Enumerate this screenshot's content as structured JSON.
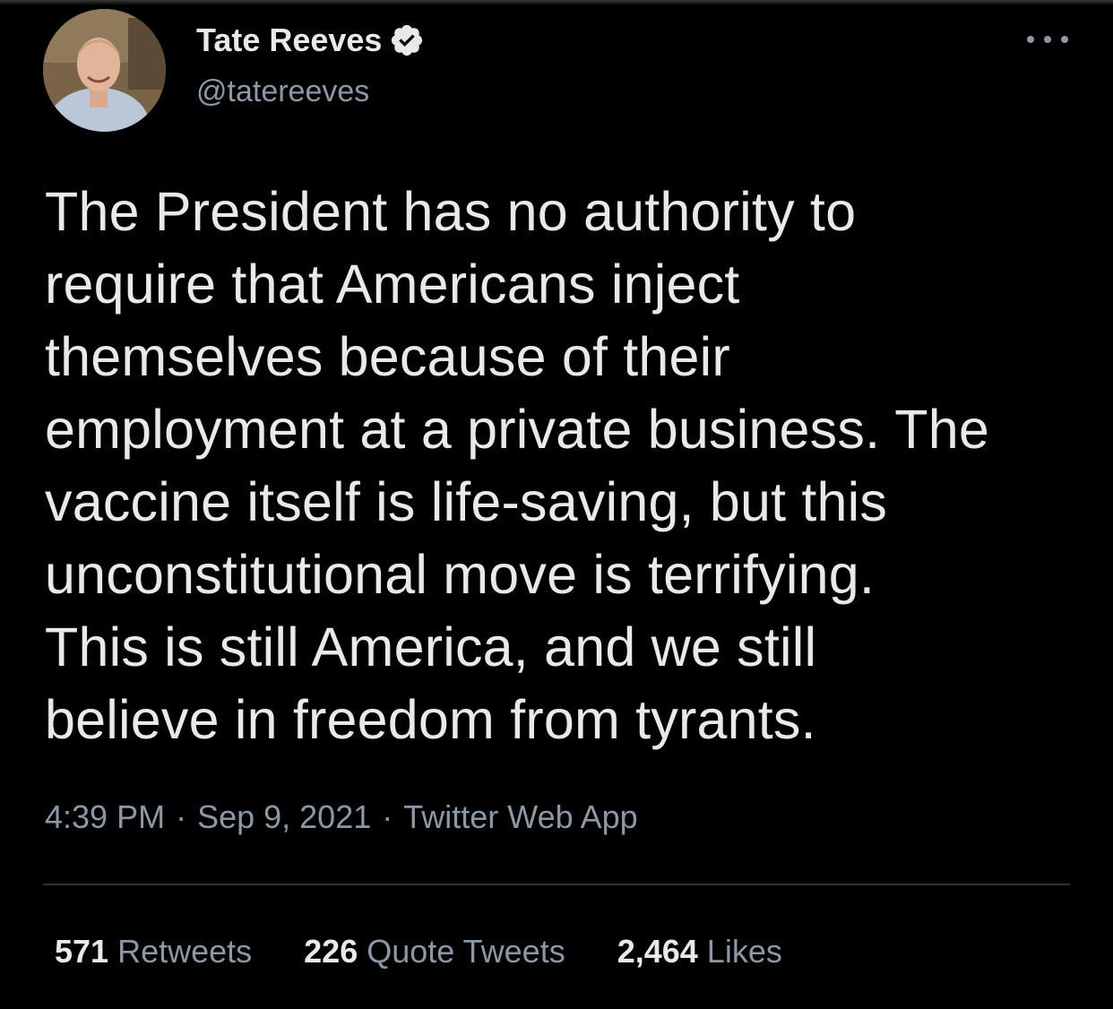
{
  "tweet": {
    "author": {
      "display_name": "Tate Reeves",
      "handle": "@tatereeves",
      "verified": true
    },
    "text_lines": [
      "The President has no authority to",
      "require that Americans inject",
      "themselves because of their",
      "employment at a private business. The",
      "vaccine itself is life-saving, but this",
      "unconstitutional move is terrifying.",
      "This is still America, and we still",
      "believe in freedom from tyrants."
    ],
    "time": "4:39 PM",
    "date": "Sep 9, 2021",
    "source": "Twitter Web App",
    "separator": "·"
  },
  "stats": {
    "retweets": {
      "count": "571",
      "label": "Retweets"
    },
    "quotes": {
      "count": "226",
      "label": "Quote Tweets"
    },
    "likes": {
      "count": "2,464",
      "label": "Likes"
    }
  },
  "icons": {
    "verified": "verified-badge-icon",
    "more": "more-options-icon"
  },
  "colors": {
    "background": "#000000",
    "primary_text": "#e7e9ea",
    "secondary_text": "#8b98a5",
    "divider": "#2f3336"
  }
}
